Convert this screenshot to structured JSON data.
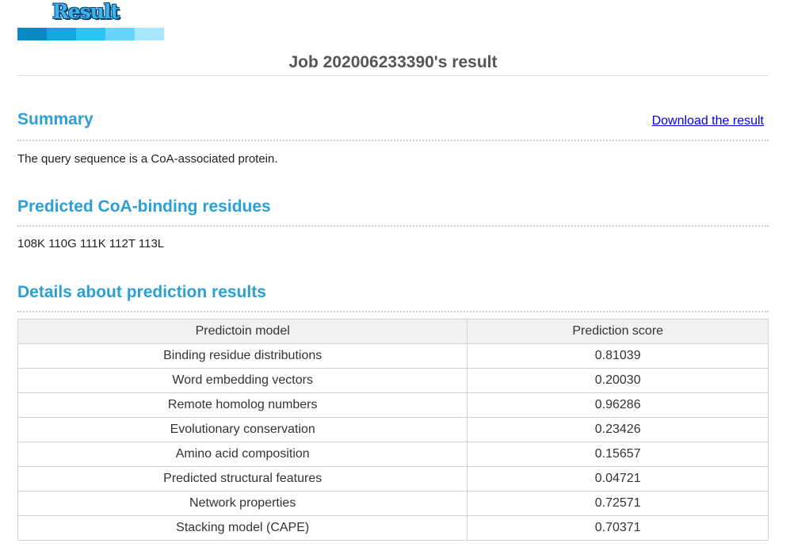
{
  "logo": {
    "text": "Result",
    "bar_colors": [
      "#0989c6",
      "#12a7e2",
      "#29c5f6",
      "#66d6fb",
      "#a6e7fd"
    ]
  },
  "colors": {
    "section_title": "#2c9fd4",
    "link": "#0000ee"
  },
  "job": {
    "title": "Job 202006233390's result"
  },
  "summary": {
    "title": "Summary",
    "download_label": "Download the result",
    "text": "The query sequence is a CoA-associated protein."
  },
  "binding": {
    "title": "Predicted CoA-binding residues",
    "residues": "108K 110G 111K 112T 113L"
  },
  "details": {
    "title": "Details about prediction results",
    "headers": [
      "Predictoin model",
      "Prediction score"
    ],
    "rows": [
      {
        "model": "Binding residue distributions",
        "score": "0.81039"
      },
      {
        "model": "Word embedding vectors",
        "score": "0.20030"
      },
      {
        "model": "Remote homolog numbers",
        "score": "0.96286"
      },
      {
        "model": "Evolutionary conservation",
        "score": "0.23426"
      },
      {
        "model": "Amino acid composition",
        "score": "0.15657"
      },
      {
        "model": "Predicted structural features",
        "score": "0.04721"
      },
      {
        "model": "Network properties",
        "score": "0.72571"
      },
      {
        "model": "Stacking model (CAPE)",
        "score": "0.70371"
      }
    ]
  }
}
